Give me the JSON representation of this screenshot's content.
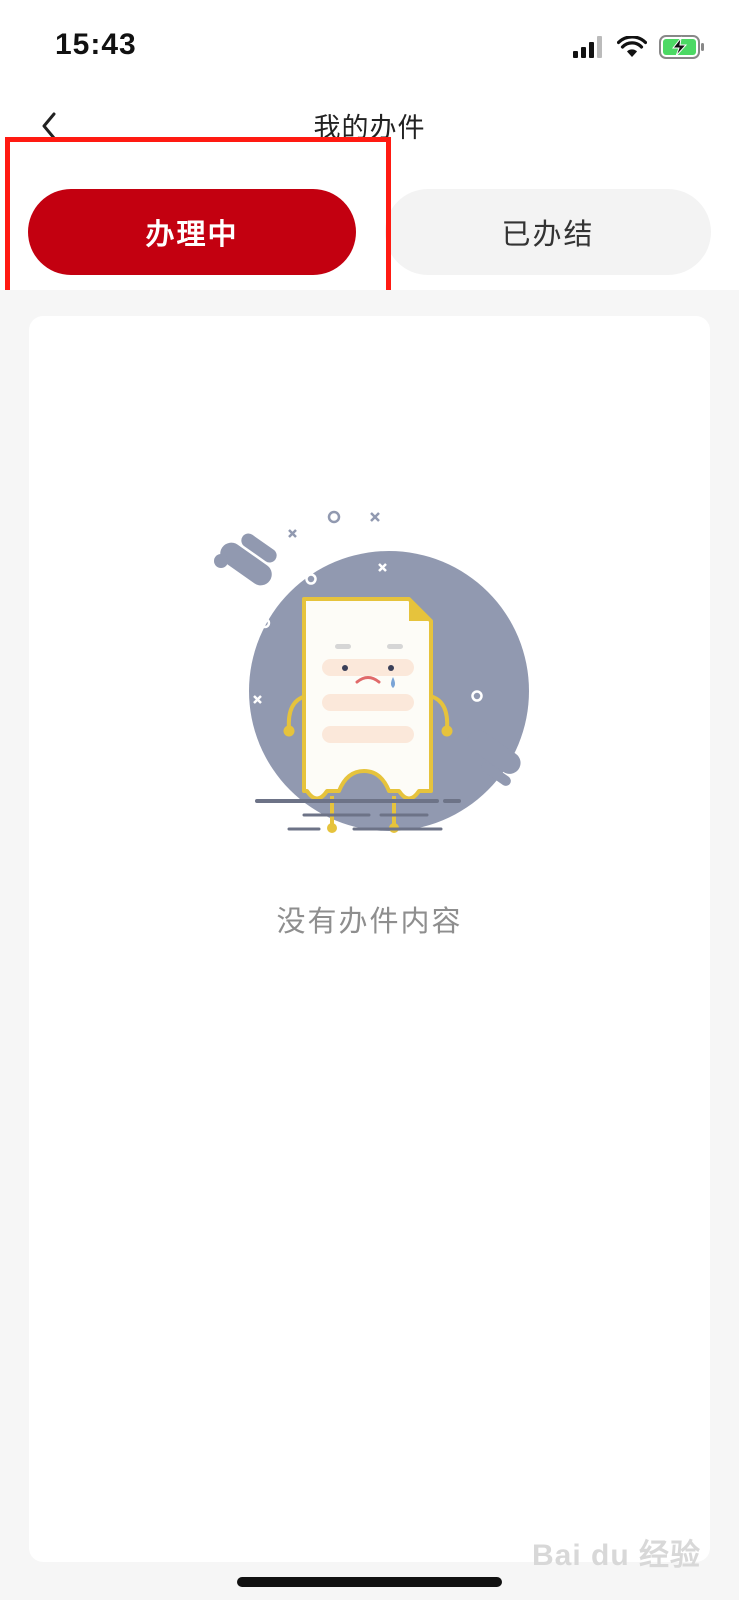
{
  "status_bar": {
    "time": "15:43",
    "icons": [
      "signal-icon",
      "wifi-icon",
      "battery-charging-icon"
    ]
  },
  "nav": {
    "title": "我的办件",
    "back_icon": "chevron-left-icon"
  },
  "tabs": [
    {
      "label": "办理中",
      "active": true
    },
    {
      "label": "已办结",
      "active": false
    }
  ],
  "empty_state": {
    "message": "没有办件内容",
    "illustration": "sad-document-illustration"
  },
  "colors": {
    "accent": "#c30010",
    "highlight": "#ff1a12",
    "tab_inactive_bg": "#f3f3f3",
    "page_bg": "#f6f6f6"
  }
}
